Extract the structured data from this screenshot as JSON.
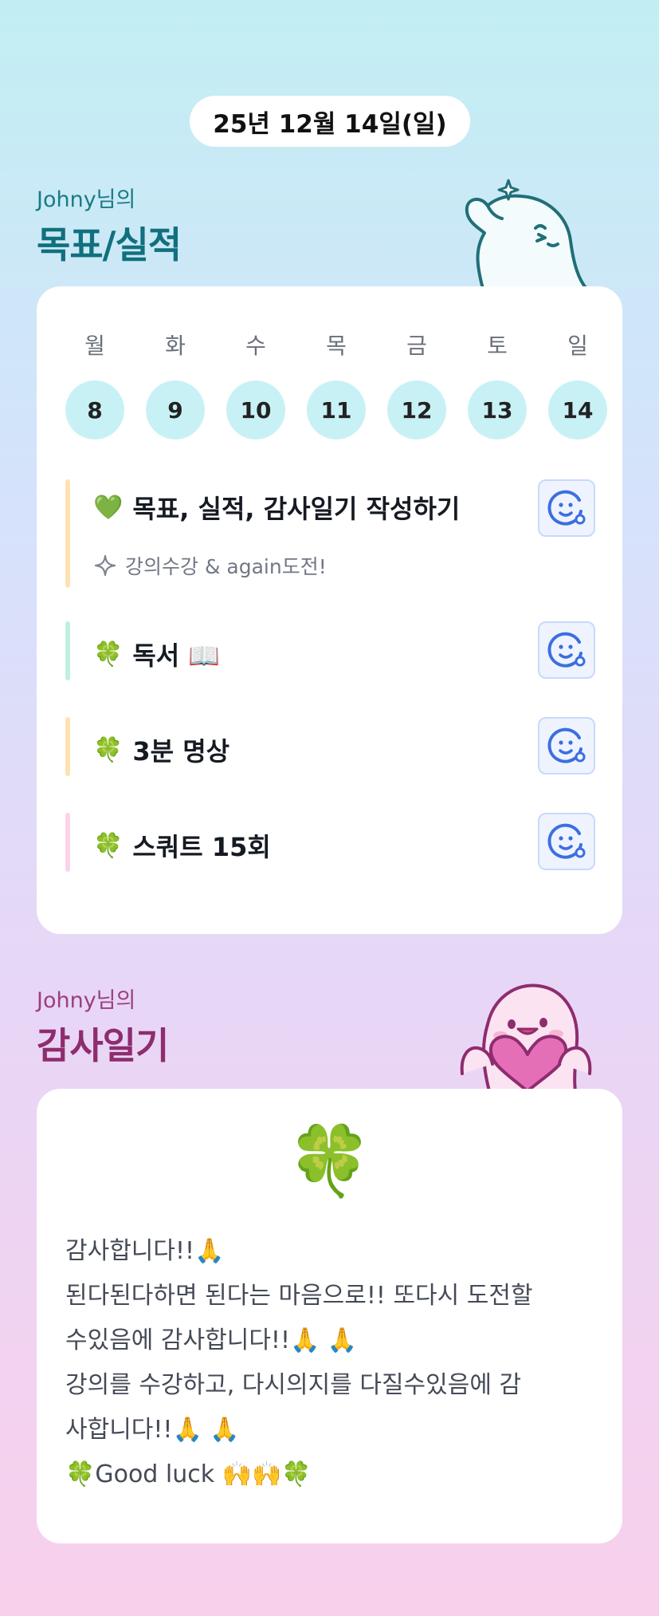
{
  "date_label": "25년 12월 14일(일)",
  "goals_section": {
    "subtitle": "Johny님의",
    "title": "목표/실적"
  },
  "week": {
    "days_of_week": [
      "월",
      "화",
      "수",
      "목",
      "금",
      "토",
      "일"
    ],
    "dates": [
      "8",
      "9",
      "10",
      "11",
      "12",
      "13",
      "14"
    ]
  },
  "tasks": [
    {
      "emoji": "💚",
      "label": "목표, 실적, 감사일기 작성하기",
      "note": "강의수강 & again도전!",
      "note_icon": "sparkle-icon",
      "bar_color": "#fde3b4"
    },
    {
      "emoji": "🍀",
      "label": "독서 📖",
      "bar_color": "#bff0de"
    },
    {
      "emoji": "🍀",
      "label": "3분 명상",
      "bar_color": "#fde3b4"
    },
    {
      "emoji": "🍀",
      "label": "스쿼트 15회",
      "bar_color": "#fbd3ea"
    }
  ],
  "diary_section": {
    "subtitle": "Johny님의",
    "title": "감사일기"
  },
  "diary": {
    "icon": "🍀",
    "lines": [
      "감사합니다!!🙏",
      "된다된다하면 된다는 마음으로!! 또다시 도전할",
      "수있음에 감사합니다!!🙏 🙏",
      "강의를 수강하고, 다시의지를 다질수있음에 감",
      "사합니다!!🙏 🙏",
      "🍀Good luck 🙌🙌🍀"
    ]
  },
  "colors": {
    "accent_teal": "#10707e",
    "accent_magenta": "#8e2c6e",
    "smiley_blue": "#3b6fe0"
  }
}
